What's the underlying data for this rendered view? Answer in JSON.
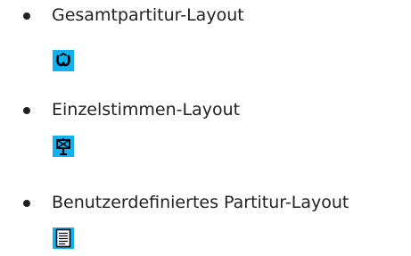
{
  "layouts": [
    {
      "label": "Gesamtpartitur-Layout",
      "icon": "full-score-layout-icon"
    },
    {
      "label": "Einzelstimmen-Layout",
      "icon": "part-layout-icon"
    },
    {
      "label": "Benutzerdefiniertes Partitur-Layout",
      "icon": "custom-score-layout-icon"
    }
  ],
  "colors": {
    "icon_background": "#12b2f0",
    "text": "#222222"
  }
}
